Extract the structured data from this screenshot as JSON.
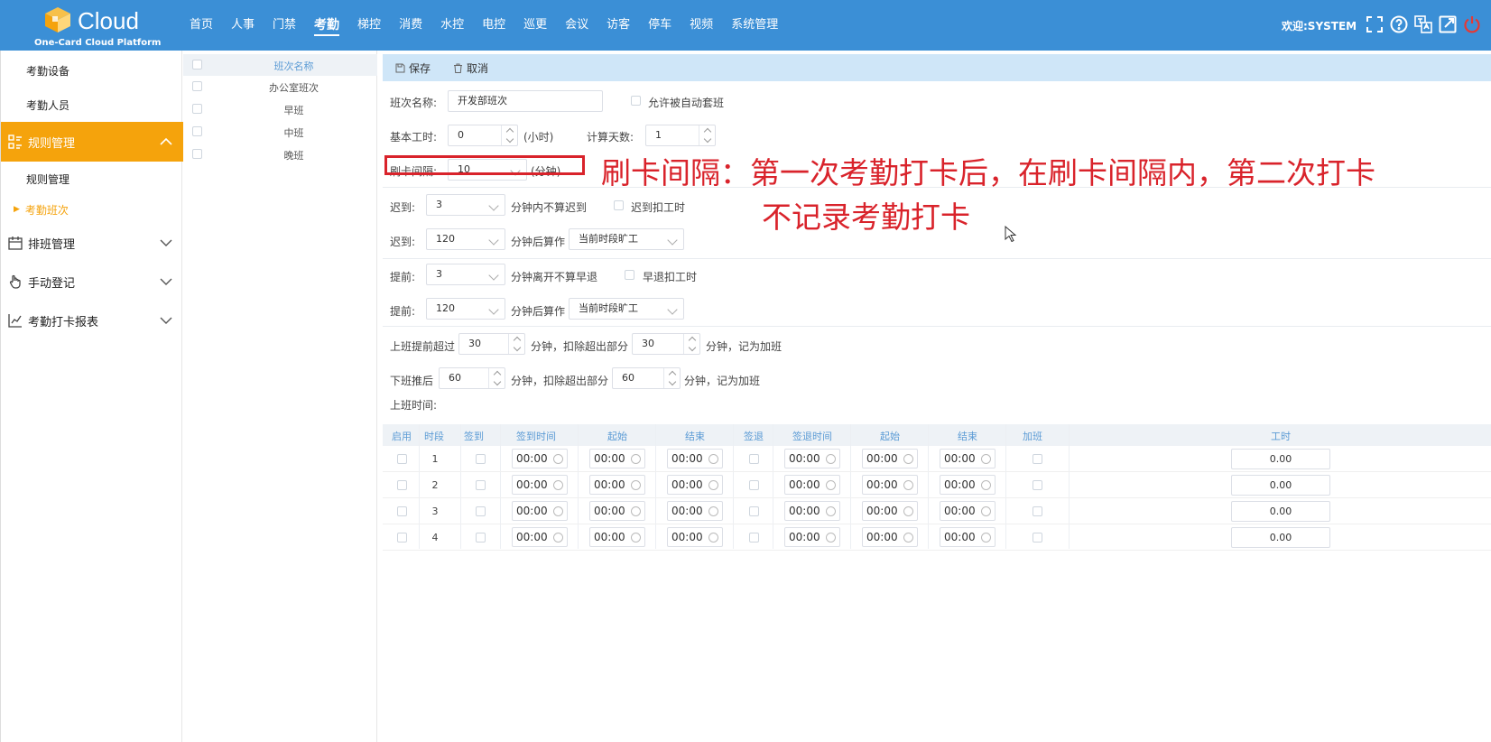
{
  "header": {
    "brand": "Cloud",
    "subtitle": "One-Card Cloud Platform",
    "nav": [
      "首页",
      "人事",
      "门禁",
      "考勤",
      "梯控",
      "消费",
      "水控",
      "电控",
      "巡更",
      "会议",
      "访客",
      "停车",
      "视频",
      "系统管理"
    ],
    "active_nav": "考勤",
    "welcome": "欢迎:SYSTEM",
    "tools": [
      "fullscreen-icon",
      "help-icon",
      "language-icon",
      "external-link-icon",
      "power-icon"
    ]
  },
  "sidebar": {
    "items": [
      {
        "label": "考勤设备",
        "type": "sub"
      },
      {
        "label": "考勤人员",
        "type": "sub"
      },
      {
        "label": "规则管理",
        "type": "group",
        "active": true,
        "icon": "rules-icon"
      },
      {
        "label": "规则管理",
        "type": "sub"
      },
      {
        "label": "考勤班次",
        "type": "sub",
        "current": true
      },
      {
        "label": "排班管理",
        "type": "group",
        "icon": "calendar-icon"
      },
      {
        "label": "手动登记",
        "type": "group",
        "icon": "hand-icon"
      },
      {
        "label": "考勤打卡报表",
        "type": "group",
        "icon": "chart-icon"
      }
    ]
  },
  "shift_list": {
    "header": "班次名称",
    "rows": [
      "办公室班次",
      "早班",
      "中班",
      "晚班"
    ]
  },
  "toolbar": {
    "save": "保存",
    "cancel": "取消"
  },
  "form": {
    "shift_name_label": "班次名称:",
    "shift_name_value": "开发部班次",
    "auto_match_label": "允许被自动套班",
    "base_hours_label": "基本工时:",
    "base_hours_value": "0",
    "base_hours_unit": "(小时)",
    "calc_days_label": "计算天数:",
    "calc_days_value": "1",
    "swipe_interval_label": "刷卡间隔:",
    "swipe_interval_value": "10",
    "swipe_interval_unit": "(分钟)",
    "late1_label": "迟到:",
    "late1_value": "3",
    "late1_text": "分钟内不算迟到",
    "late1_check_label": "迟到扣工时",
    "late2_label": "迟到:",
    "late2_value": "120",
    "late2_text": "分钟后算作",
    "late2_select": "当前时段旷工",
    "early1_label": "提前:",
    "early1_value": "3",
    "early1_text": "分钟离开不算早退",
    "early1_check_label": "早退扣工时",
    "early2_label": "提前:",
    "early2_value": "120",
    "early2_text": "分钟后算作",
    "early2_select": "当前时段旷工",
    "ot_before_label": "上班提前超过",
    "ot_before_value": "30",
    "ot_before_mid": "分钟，扣除超出部分",
    "ot_before_value2": "30",
    "ot_before_tail": "分钟，记为加班",
    "ot_after_label": "下班推后",
    "ot_after_value": "60",
    "ot_after_mid": "分钟，扣除超出部分",
    "ot_after_value2": "60",
    "ot_after_tail": "分钟，记为加班",
    "work_time_label": "上班时间:"
  },
  "annotation": {
    "line1": "刷卡间隔：第一次考勤打卡后，在刷卡间隔内，第二次打卡",
    "line2": "不记录考勤打卡"
  },
  "schedule": {
    "columns": [
      "启用",
      "时段",
      "签到",
      "签到时间",
      "起始",
      "结束",
      "签退",
      "签退时间",
      "起始",
      "结束",
      "加班",
      "工时"
    ],
    "rows": [
      {
        "period": "1",
        "times": [
          "00:00",
          "00:00",
          "00:00",
          "00:00",
          "00:00",
          "00:00"
        ],
        "hours": "0.00"
      },
      {
        "period": "2",
        "times": [
          "00:00",
          "00:00",
          "00:00",
          "00:00",
          "00:00",
          "00:00"
        ],
        "hours": "0.00"
      },
      {
        "period": "3",
        "times": [
          "00:00",
          "00:00",
          "00:00",
          "00:00",
          "00:00",
          "00:00"
        ],
        "hours": "0.00"
      },
      {
        "period": "4",
        "times": [
          "00:00",
          "00:00",
          "00:00",
          "00:00",
          "00:00",
          "00:00"
        ],
        "hours": "0.00"
      }
    ]
  },
  "colors": {
    "header": "#3b8fd6",
    "active": "#f5a30c",
    "annotation": "#d9232b"
  }
}
